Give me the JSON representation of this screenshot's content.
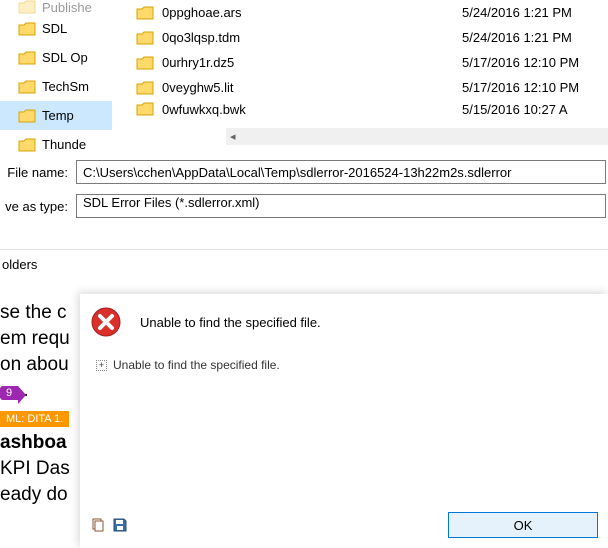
{
  "tree": {
    "items": [
      {
        "label": "Publishe"
      },
      {
        "label": "SDL"
      },
      {
        "label": "SDL Op"
      },
      {
        "label": "TechSm"
      },
      {
        "label": "Temp"
      },
      {
        "label": "Thunde"
      }
    ],
    "selected_index": 4
  },
  "files": [
    {
      "name": "0ppghoae.ars",
      "date": "5/24/2016 1:21 PM"
    },
    {
      "name": "0qo3lqsp.tdm",
      "date": "5/24/2016 1:21 PM"
    },
    {
      "name": "0urhry1r.dz5",
      "date": "5/17/2016 12:10 PM"
    },
    {
      "name": "0veyghw5.lit",
      "date": "5/17/2016 12:10 PM"
    },
    {
      "name": "0wfuwkxq.bwk",
      "date": "5/15/2016 10:27 A"
    }
  ],
  "fields": {
    "file_name_label": "File name:",
    "file_name_value": "C:\\Users\\cchen\\AppData\\Local\\Temp\\sdlerror-2016524-13h22m2s.sdlerror",
    "save_type_label": "ve as type:",
    "save_type_value": "SDL Error Files (*.sdlerror.xml)"
  },
  "bottom_bar": {
    "label": "olders"
  },
  "background": {
    "line1": "se the c",
    "line2": "em requ",
    "line3": "on abou",
    "badge1": "9",
    "line4": ".",
    "badge2": "ML: DITA 1.",
    "line5": "ashboa",
    "line6": "KPI Das",
    "line7": "eady do"
  },
  "error": {
    "title": "Unable to find the specified file.",
    "detail": "Unable to find the specified file.",
    "ok_label": "OK"
  }
}
